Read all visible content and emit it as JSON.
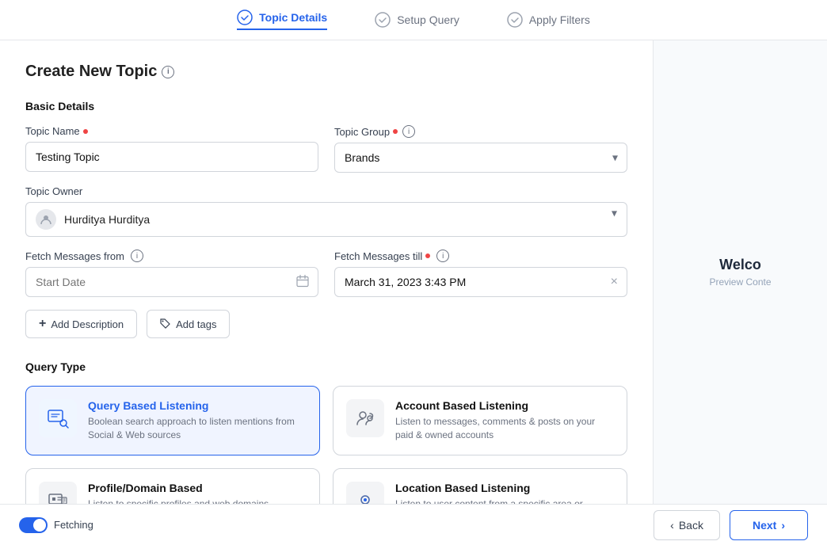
{
  "nav": {
    "steps": [
      {
        "id": "topic-details",
        "label": "Topic Details",
        "active": true
      },
      {
        "id": "setup-query",
        "label": "Setup Query",
        "active": false
      },
      {
        "id": "apply-filters",
        "label": "Apply Filters",
        "active": false
      }
    ]
  },
  "page": {
    "title": "Create New Topic"
  },
  "basicDetails": {
    "sectionTitle": "Basic Details",
    "topicNameLabel": "Topic Name",
    "topicNameValue": "Testing Topic",
    "topicNamePlaceholder": "Topic Name",
    "topicGroupLabel": "Topic Group",
    "topicGroupValue": "Brands",
    "topicOwnerLabel": "Topic Owner",
    "topicOwnerValue": "Hurditya Hurditya",
    "fetchFromLabel": "Fetch Messages from",
    "fetchFromPlaceholder": "Start Date",
    "fetchTillLabel": "Fetch Messages till",
    "fetchTillValue": "March 31, 2023 3:43 PM"
  },
  "actions": {
    "addDescription": "Add Description",
    "addTags": "Add tags"
  },
  "queryType": {
    "sectionTitle": "Query Type",
    "cards": [
      {
        "id": "query-based",
        "title": "Query Based Listening",
        "description": "Boolean search approach to listen mentions from Social & Web sources",
        "selected": true,
        "icon": "search"
      },
      {
        "id": "account-based",
        "title": "Account Based Listening",
        "description": "Listen to messages, comments & posts on your paid & owned accounts",
        "selected": false,
        "icon": "users"
      },
      {
        "id": "profile-domain",
        "title": "Profile/Domain Based",
        "description": "Listen to specific profiles and web domains",
        "selected": false,
        "icon": "profile"
      },
      {
        "id": "location-based",
        "title": "Location Based Listening",
        "description": "Listen to user content from a specific area or",
        "selected": false,
        "icon": "location"
      }
    ]
  },
  "preview": {
    "welcome": "Welco",
    "sub": "Preview Conte"
  },
  "footer": {
    "fetchingLabel": "Fetching",
    "backLabel": "Back",
    "nextLabel": "Next"
  }
}
